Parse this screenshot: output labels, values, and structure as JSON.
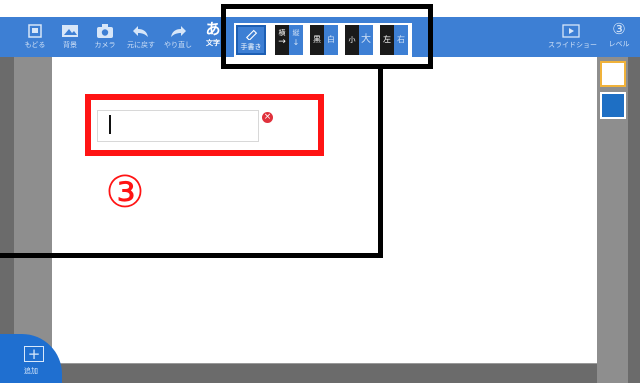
{
  "toolbar": {
    "items": [
      {
        "label": "もどる",
        "icon": "back-icon"
      },
      {
        "label": "背景",
        "icon": "image-icon"
      },
      {
        "label": "カメラ",
        "icon": "camera-icon"
      },
      {
        "label": "元に戻す",
        "icon": "undo-icon"
      },
      {
        "label": "やり直し",
        "icon": "redo-icon"
      },
      {
        "label": "文字",
        "icon": "text-icon",
        "glyph": "あ"
      }
    ],
    "right_items": [
      {
        "label": "スライドショー",
        "icon": "slideshow-icon"
      },
      {
        "label": "レベル",
        "icon": "level-icon",
        "glyph": "③"
      }
    ]
  },
  "text_style": {
    "handwriting_label": "手書き",
    "horizontal_label": "横",
    "vertical_label": "縦",
    "black_label": "黒",
    "white_label": "白",
    "small_label": "小",
    "large_label": "大",
    "left_label": "左",
    "right_label": "右"
  },
  "text_box": {
    "value": "",
    "placeholder": ""
  },
  "annotation": {
    "step": "③"
  },
  "add_button": {
    "label": "追加"
  },
  "colors": {
    "toolbar": "#3d7fd4",
    "highlight_red": "#ff1414",
    "swatch_top_border": "#f0b23a",
    "swatch_bottom": "#1e6fc4"
  }
}
